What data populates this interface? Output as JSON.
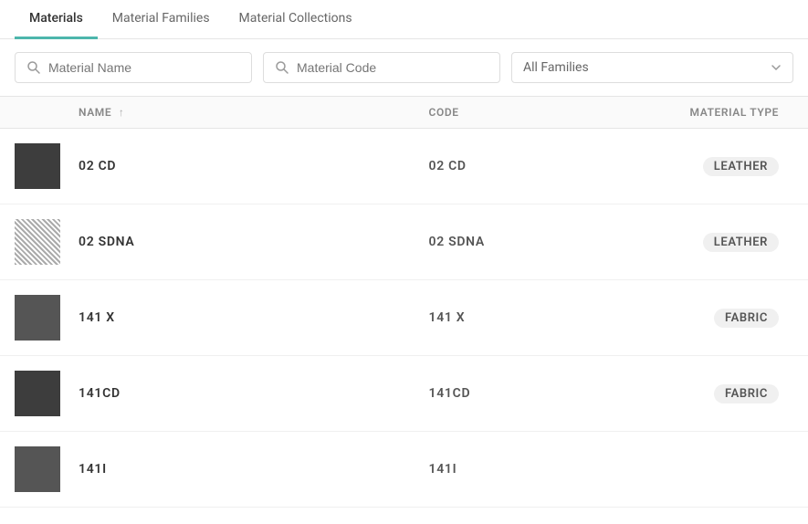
{
  "tabs": [
    {
      "id": "materials",
      "label": "Materials",
      "active": true
    },
    {
      "id": "families",
      "label": "Material Families",
      "active": false
    },
    {
      "id": "collections",
      "label": "Material Collections",
      "active": false
    }
  ],
  "filters": {
    "name_placeholder": "Material Name",
    "code_placeholder": "Material Code",
    "families_label": "All Families"
  },
  "table": {
    "columns": {
      "name": "NAME",
      "code": "CODE",
      "material_type": "MATERIAL TYPE"
    },
    "rows": [
      {
        "id": 1,
        "name": "02 CD",
        "code": "02 CD",
        "type": "Leather",
        "thumb": "solid"
      },
      {
        "id": 2,
        "name": "02 sDNA",
        "code": "02 SDNA",
        "type": "Leather",
        "thumb": "pattern"
      },
      {
        "id": 3,
        "name": "141 X",
        "code": "141 X",
        "type": "Fabric",
        "thumb": "medium"
      },
      {
        "id": 4,
        "name": "141CD",
        "code": "141CD",
        "type": "Fabric",
        "thumb": "solid"
      },
      {
        "id": 5,
        "name": "141I",
        "code": "141I",
        "type": "",
        "thumb": "medium"
      }
    ]
  }
}
